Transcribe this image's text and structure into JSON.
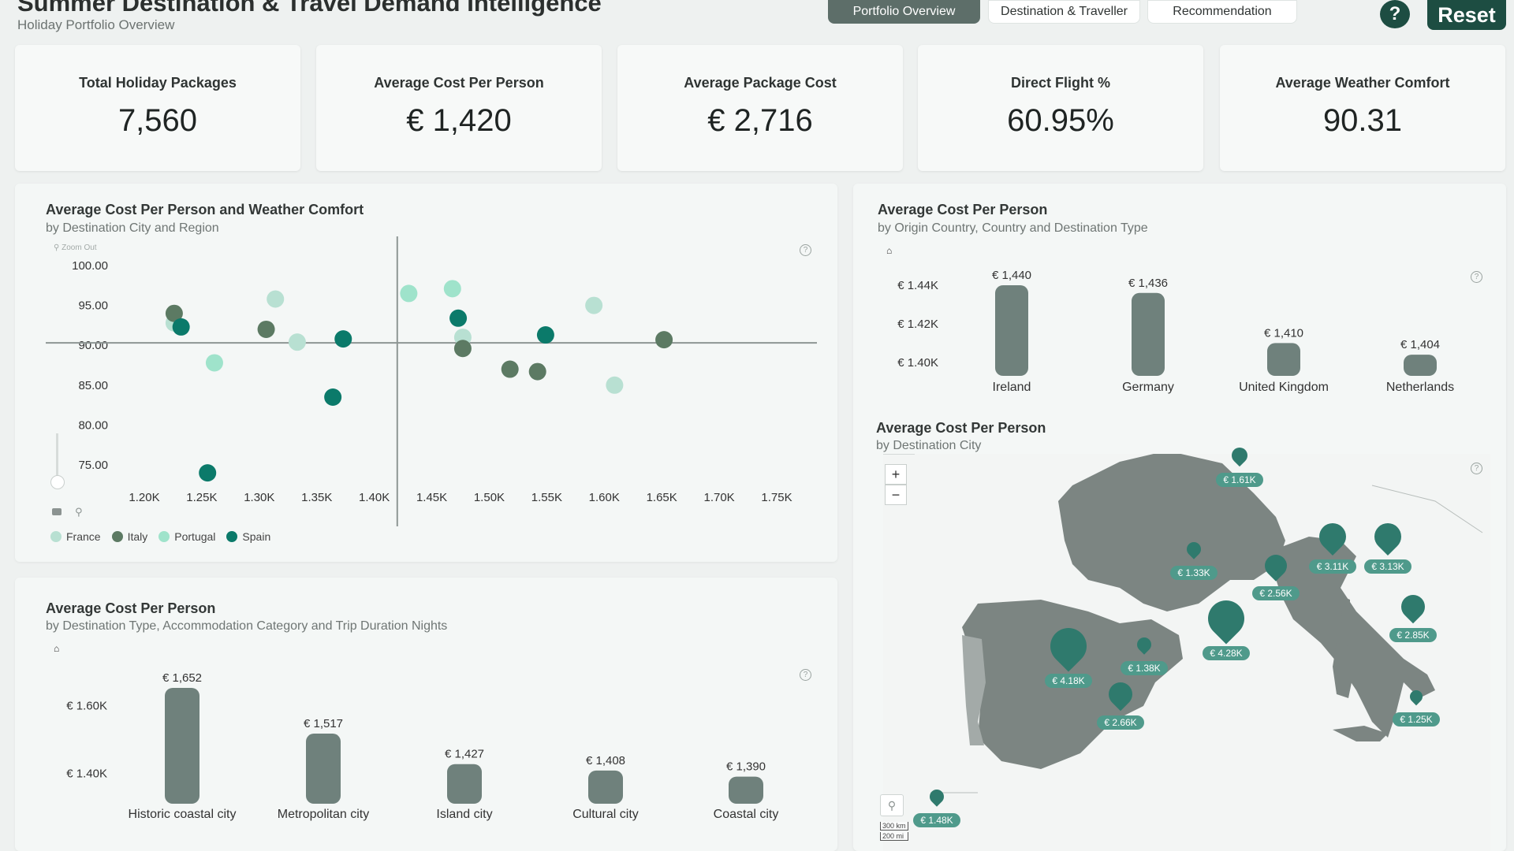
{
  "header": {
    "title": "Summer Destination & Travel Demand Intelligence",
    "subtitle": "Holiday Portfolio Overview"
  },
  "nav": {
    "tabs": [
      {
        "label": "Portfolio Overview",
        "active": true
      },
      {
        "label": "Destination & Traveller",
        "active": false
      },
      {
        "label": "Recommendation",
        "active": false
      }
    ],
    "help_label": "?",
    "reset_label": "Reset"
  },
  "kpis": [
    {
      "label": "Total Holiday Packages",
      "value": "7,560"
    },
    {
      "label": "Average Cost Per Person",
      "value": "€ 1,420"
    },
    {
      "label": "Average Package Cost",
      "value": "€ 2,716"
    },
    {
      "label": "Direct Flight %",
      "value": "60.95%"
    },
    {
      "label": "Average Weather Comfort",
      "value": "90.31"
    }
  ],
  "scatter_panel": {
    "title": "Average Cost Per Person and Weather Comfort",
    "subtitle": "by Destination City and Region",
    "zoom_out_label": "Zoom Out"
  },
  "country_panel": {
    "title": "Average Cost Per Person",
    "subtitle": "by Origin Country, Country and Destination Type"
  },
  "type_panel": {
    "title": "Average Cost Per Person",
    "subtitle": "by Destination Type, Accommodation Category and Trip Duration Nights"
  },
  "map_panel": {
    "title": "Average Cost Per Person",
    "subtitle": "by Destination City",
    "zoom_in": "+",
    "zoom_out": "−",
    "scale_km": "300 km",
    "scale_mi": "200 mi",
    "pins": [
      {
        "label": "€ 1.61K"
      },
      {
        "label": "€ 1.33K"
      },
      {
        "label": "€ 2.56K"
      },
      {
        "label": "€ 3.11K"
      },
      {
        "label": "€ 3.13K"
      },
      {
        "label": "€ 2.85K"
      },
      {
        "label": "€ 1.38K"
      },
      {
        "label": "€ 4.28K"
      },
      {
        "label": "€ 4.18K"
      },
      {
        "label": "€ 2.66K"
      },
      {
        "label": "€ 1.25K"
      },
      {
        "label": "€ 1.48K"
      }
    ]
  },
  "colors": {
    "france": "#b8e0d2",
    "italy": "#5c7a63",
    "portugal": "#9fe3cb",
    "spain": "#0b7a6a",
    "bar": "#6f817c",
    "land": "#7c8582",
    "pin": "#2f7a6d"
  },
  "chart_data": [
    {
      "type": "scatter",
      "title": "Average Cost Per Person and Weather Comfort",
      "subtitle": "by Destination City and Region",
      "xlabel": "",
      "ylabel": "",
      "xlim": [
        1150,
        1800
      ],
      "ylim": [
        73,
        101
      ],
      "x_ticks": [
        "1.20K",
        "1.25K",
        "1.30K",
        "1.35K",
        "1.40K",
        "1.45K",
        "1.50K",
        "1.55K",
        "1.60K",
        "1.65K",
        "1.70K",
        "1.75K"
      ],
      "y_ticks": [
        "100.00",
        "95.00",
        "90.00",
        "85.00",
        "80.00",
        "75.00"
      ],
      "reference_x": 1420,
      "reference_y": 90.31,
      "legend": {
        "position": "bottom-left",
        "entries": [
          "France",
          "Italy",
          "Portugal",
          "Spain"
        ]
      },
      "series": [
        {
          "name": "France",
          "color": "#b8e0d2",
          "points": [
            [
              1226,
              92.8
            ],
            [
              1314,
              95.8
            ],
            [
              1333,
              90.4
            ],
            [
              1591,
              95.0
            ],
            [
              1609,
              85.0
            ],
            [
              1477,
              91.0
            ]
          ]
        },
        {
          "name": "Italy",
          "color": "#5c7a63",
          "points": [
            [
              1226,
              94.0
            ],
            [
              1306,
              92.0
            ],
            [
              1477,
              89.6
            ],
            [
              1518,
              87.0
            ],
            [
              1542,
              86.7
            ],
            [
              1652,
              90.7
            ]
          ]
        },
        {
          "name": "Portugal",
          "color": "#9fe3cb",
          "points": [
            [
              1261,
              87.8
            ],
            [
              1430,
              96.5
            ],
            [
              1468,
              97.1
            ]
          ]
        },
        {
          "name": "Spain",
          "color": "#0b7a6a",
          "points": [
            [
              1232,
              92.3
            ],
            [
              1255,
              74.0
            ],
            [
              1373,
              90.8
            ],
            [
              1364,
              83.5
            ],
            [
              1473,
              93.4
            ],
            [
              1549,
              91.3
            ]
          ]
        }
      ]
    },
    {
      "type": "bar",
      "title": "Average Cost Per Person",
      "subtitle": "by Origin Country, Country and Destination Type",
      "categories": [
        "Ireland",
        "Germany",
        "United Kingdom",
        "Netherlands"
      ],
      "values": [
        1440,
        1436,
        1410,
        1404
      ],
      "data_labels": [
        "€ 1,440",
        "€ 1,436",
        "€ 1,410",
        "€ 1,404"
      ],
      "y_ticks": [
        "€ 1.44K",
        "€ 1.42K",
        "€ 1.40K"
      ],
      "ylim": [
        1393,
        1446
      ]
    },
    {
      "type": "bar",
      "title": "Average Cost Per Person",
      "subtitle": "by Destination Type, Accommodation Category and Trip Duration Nights",
      "categories": [
        "Historic coastal city",
        "Metropolitan city",
        "Island city",
        "Cultural city",
        "Coastal city"
      ],
      "values": [
        1652,
        1517,
        1427,
        1408,
        1390
      ],
      "data_labels": [
        "€ 1,652",
        "€ 1,517",
        "€ 1,427",
        "€ 1,408",
        "€ 1,390"
      ],
      "y_ticks": [
        "€ 1.60K",
        "€ 1.40K"
      ],
      "ylim": [
        1310,
        1680
      ]
    }
  ]
}
